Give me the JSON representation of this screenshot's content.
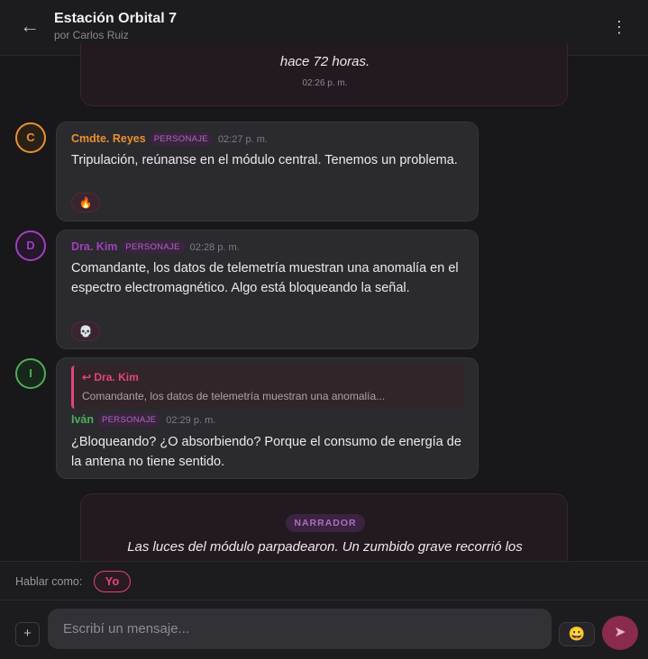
{
  "header": {
    "back_icon": "←",
    "title": "Estación Orbital 7",
    "subtitle": "por Carlos Ruiz",
    "more_icon": "⋮"
  },
  "narration_top": {
    "text": "hace 72 horas.",
    "time": "02:26 p. m."
  },
  "messages": [
    {
      "initial": "C",
      "color": "#e8912e",
      "name": "Cmdte. Reyes",
      "tag": "PERSONAJE",
      "time": "02:27 p. m.",
      "text": "Tripulación, reúnanse en el módulo central. Tenemos un problema.",
      "reaction": "🔥"
    },
    {
      "initial": "D",
      "color": "#a23fbd",
      "name": "Dra. Kim",
      "tag": "PERSONAJE",
      "time": "02:28 p. m.",
      "text": "Comandante, los datos de telemetría muestran una anomalía en el espectro electromagnético. Algo está bloqueando la señal.",
      "reaction": "💀"
    },
    {
      "initial": "I",
      "color": "#4cae5b",
      "name": "Iván",
      "tag": "PERSONAJE",
      "time": "02:29 p. m.",
      "reply": {
        "name": "↩ Dra. Kim",
        "text": "Comandante, los datos de telemetría muestran una anomalía..."
      },
      "text": "¿Bloqueando? ¿O absorbiendo? Porque el consumo de energía de la antena no tiene sentido."
    }
  ],
  "narration_bottom": {
    "badge": "NARRADOR",
    "text": "Las luces del módulo parpadearon. Un zumbido grave recorrió los"
  },
  "speak_as": {
    "label": "Hablar como:",
    "value": "Yo"
  },
  "composer": {
    "plus_icon": "+",
    "placeholder": "Escribí un mensaje...",
    "emoji_icon": "😀",
    "send_icon": "➤"
  }
}
